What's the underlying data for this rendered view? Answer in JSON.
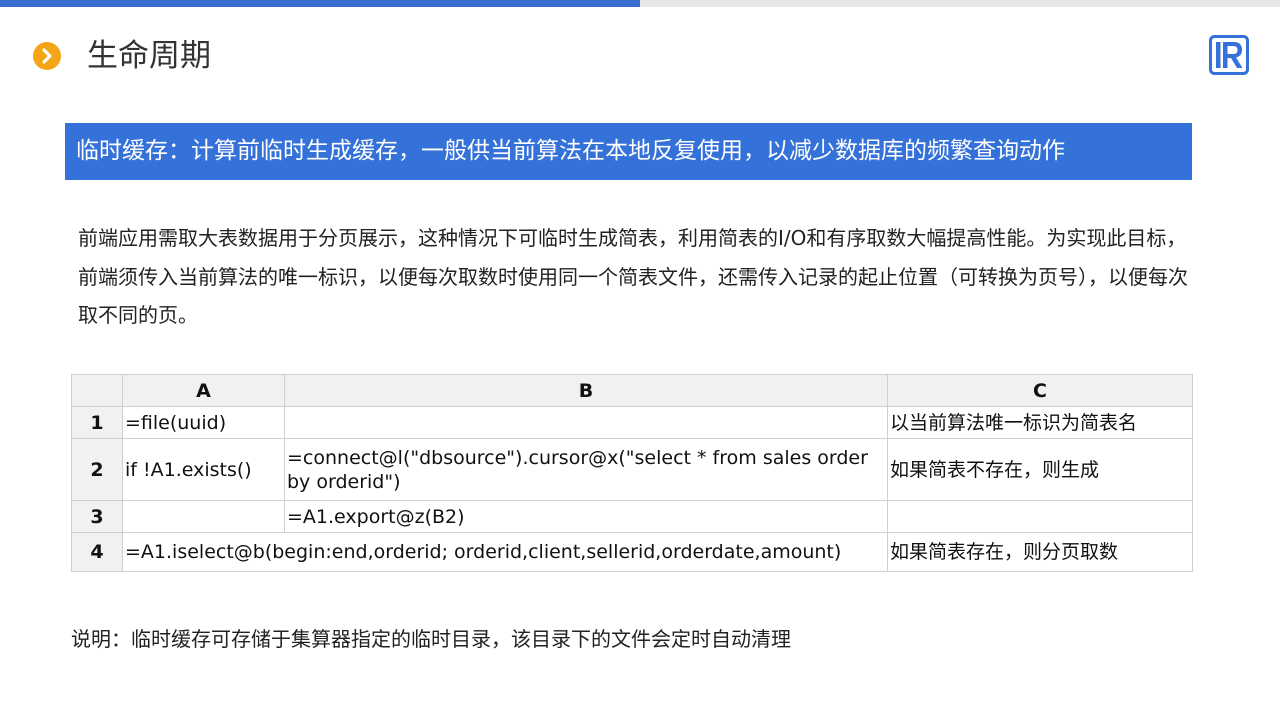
{
  "slide": {
    "progress_fraction": 0.5,
    "title": "生命周期",
    "banner": "临时缓存：计算前临时生成缓存，一般供当前算法在本地反复使用，以减少数据库的频繁查询动作",
    "paragraph": "前端应用需取大表数据用于分页展示，这种情况下可临时生成简表，利用简表的I/O和有序取数大幅提高性能。为实现此目标，前端须传入当前算法的唯一标识，以便每次取数时使用同一个简表文件，还需传入记录的起止位置（可转换为页号），以便每次取不同的页。",
    "note": "说明：临时缓存可存储于集算器指定的临时目录，该目录下的文件会定时自动清理",
    "bullet_icon": "chevron-right-icon",
    "logo_icon": "brand-r-logo-icon",
    "colors": {
      "accent_blue": "#3471d8",
      "bullet_orange": "#f3a516",
      "progress_blue": "#3a6fd1",
      "header_gray": "#f1f1f1"
    }
  },
  "table": {
    "columns": [
      "A",
      "B",
      "C"
    ],
    "rows": [
      {
        "num": "1",
        "a": "=file(uuid)",
        "b": "",
        "c": "以当前算法唯一标识为简表名"
      },
      {
        "num": "2",
        "a": "if !A1.exists()",
        "b": "=connect@l(\"dbsource\").cursor@x(\"select * from sales order by orderid\")",
        "c": "如果简表不存在，则生成"
      },
      {
        "num": "3",
        "a": "",
        "b": "=A1.export@z(B2)",
        "c": ""
      },
      {
        "num": "4",
        "a": "=A1.iselect@b(begin:end,orderid; orderid,client,sellerid,orderdate,amount)",
        "c": "如果简表存在，则分页取数"
      }
    ]
  }
}
